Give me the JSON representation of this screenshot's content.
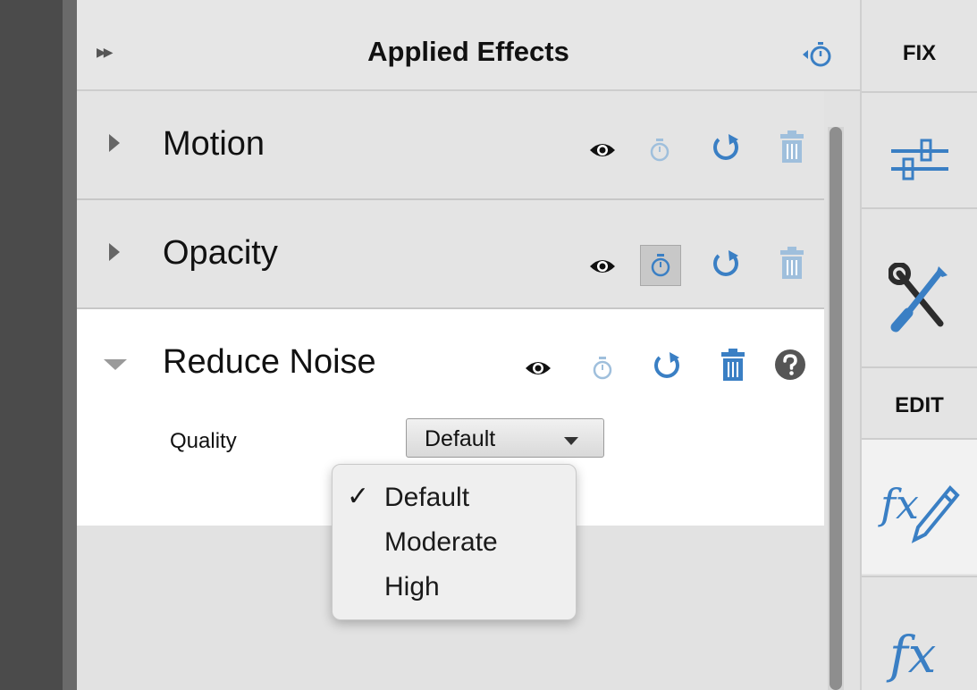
{
  "panel": {
    "title": "Applied Effects"
  },
  "effects": [
    {
      "name": "Motion",
      "expanded": false
    },
    {
      "name": "Opacity",
      "expanded": false
    },
    {
      "name": "Reduce Noise",
      "expanded": true
    }
  ],
  "reduce_noise_params": {
    "quality_label": "Quality",
    "quality_value": "Default"
  },
  "quality_menu": {
    "options": [
      "Default",
      "Moderate",
      "High"
    ],
    "selected": "Default",
    "check_glyph": "✓"
  },
  "side_tabs": {
    "fix_label": "FIX",
    "edit_label": "EDIT"
  },
  "icons": {
    "collapse": "double-chevron-right-icon",
    "keyframe_timer": "stopwatch-icon",
    "visibility": "eye-icon",
    "reset": "reset-icon",
    "delete": "trash-icon",
    "help": "help-icon",
    "adjust": "sliders-icon",
    "tools": "wrench-screwdriver-icon",
    "effects_edit": "fx-edit-icon",
    "effects": "fx-icon"
  },
  "colors": {
    "accent_blue": "#3a7fc4",
    "light_blue": "#9fbfdc",
    "panel_bg": "#e4e4e4",
    "expanded_bg": "#ffffff"
  }
}
